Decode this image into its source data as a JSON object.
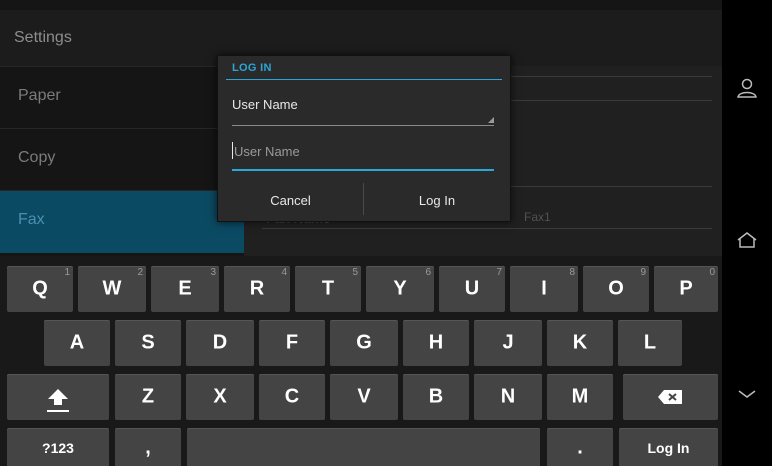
{
  "topbar": {
    "title": "Settings"
  },
  "menu": {
    "items": [
      {
        "label": "Paper"
      },
      {
        "label": "Copy"
      },
      {
        "label": "Fax"
      }
    ]
  },
  "content": {
    "fax_name_label": "Fax Name",
    "fax_name_value": "Fax1"
  },
  "dialog": {
    "title": "LOG IN",
    "spinner_value": "User Name",
    "input_placeholder": "User Name",
    "cancel_label": "Cancel",
    "login_label": "Log In"
  },
  "keyboard": {
    "row1": [
      {
        "label": "Q",
        "hint": "1"
      },
      {
        "label": "W",
        "hint": "2"
      },
      {
        "label": "E",
        "hint": "3"
      },
      {
        "label": "R",
        "hint": "4"
      },
      {
        "label": "T",
        "hint": "5"
      },
      {
        "label": "Y",
        "hint": "6"
      },
      {
        "label": "U",
        "hint": "7"
      },
      {
        "label": "I",
        "hint": "8"
      },
      {
        "label": "O",
        "hint": "9"
      },
      {
        "label": "P",
        "hint": "0"
      }
    ],
    "row2": [
      {
        "label": "A"
      },
      {
        "label": "S"
      },
      {
        "label": "D"
      },
      {
        "label": "F"
      },
      {
        "label": "G"
      },
      {
        "label": "H"
      },
      {
        "label": "J"
      },
      {
        "label": "K"
      },
      {
        "label": "L"
      }
    ],
    "row3": [
      {
        "label": "Z"
      },
      {
        "label": "X"
      },
      {
        "label": "C"
      },
      {
        "label": "V"
      },
      {
        "label": "B"
      },
      {
        "label": "N"
      },
      {
        "label": "M"
      }
    ],
    "symbols_label": "?123",
    "comma_label": ",",
    "period_label": ".",
    "action_label": "Log In"
  },
  "icons": {
    "shift": "shift-icon",
    "backspace": "backspace-icon",
    "user": "user-icon",
    "home": "home-icon",
    "back": "back-chevron-icon"
  },
  "colors": {
    "accent": "#2aa7d6",
    "selected_menu": "#0b4a63"
  }
}
